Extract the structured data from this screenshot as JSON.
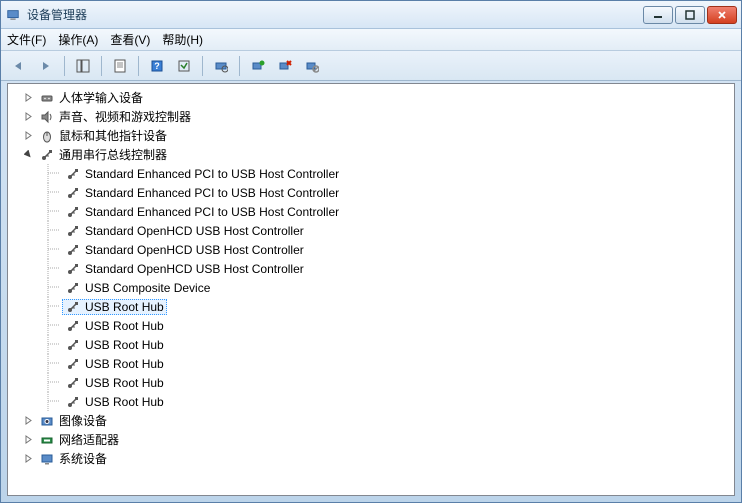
{
  "window": {
    "title": "设备管理器"
  },
  "menu": {
    "file": "文件(F)",
    "action": "操作(A)",
    "view": "查看(V)",
    "help": "帮助(H)"
  },
  "tree": {
    "nodes": [
      {
        "label": "人体学输入设备",
        "icon": "hid",
        "expanded": false,
        "depth": 0
      },
      {
        "label": "声音、视频和游戏控制器",
        "icon": "sound",
        "expanded": false,
        "depth": 0
      },
      {
        "label": "鼠标和其他指针设备",
        "icon": "mouse",
        "expanded": false,
        "depth": 0
      },
      {
        "label": "通用串行总线控制器",
        "icon": "usb",
        "expanded": true,
        "depth": 0
      },
      {
        "label": "Standard Enhanced PCI to USB Host Controller",
        "icon": "usb",
        "depth": 1
      },
      {
        "label": "Standard Enhanced PCI to USB Host Controller",
        "icon": "usb",
        "depth": 1
      },
      {
        "label": "Standard Enhanced PCI to USB Host Controller",
        "icon": "usb",
        "depth": 1
      },
      {
        "label": "Standard OpenHCD USB Host Controller",
        "icon": "usb",
        "depth": 1
      },
      {
        "label": "Standard OpenHCD USB Host Controller",
        "icon": "usb",
        "depth": 1
      },
      {
        "label": "Standard OpenHCD USB Host Controller",
        "icon": "usb",
        "depth": 1
      },
      {
        "label": "USB Composite Device",
        "icon": "usb",
        "depth": 1
      },
      {
        "label": "USB Root Hub",
        "icon": "usb",
        "depth": 1,
        "selected": true
      },
      {
        "label": "USB Root Hub",
        "icon": "usb",
        "depth": 1
      },
      {
        "label": "USB Root Hub",
        "icon": "usb",
        "depth": 1
      },
      {
        "label": "USB Root Hub",
        "icon": "usb",
        "depth": 1
      },
      {
        "label": "USB Root Hub",
        "icon": "usb",
        "depth": 1
      },
      {
        "label": "USB Root Hub",
        "icon": "usb",
        "depth": 1
      },
      {
        "label": "图像设备",
        "icon": "image",
        "expanded": false,
        "depth": 0
      },
      {
        "label": "网络适配器",
        "icon": "network",
        "expanded": false,
        "depth": 0
      },
      {
        "label": "系统设备",
        "icon": "system",
        "expanded": false,
        "depth": 0
      }
    ]
  }
}
